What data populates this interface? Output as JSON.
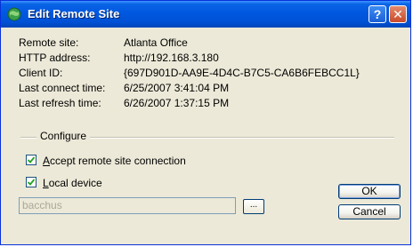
{
  "window": {
    "title": "Edit Remote Site",
    "help_label": "?",
    "close_label": "✕"
  },
  "info": {
    "rows": [
      {
        "label": "Remote site:",
        "value": "Atlanta Office"
      },
      {
        "label": "HTTP address:",
        "value": "http://192.168.3.180"
      },
      {
        "label": "Client ID:",
        "value": "{697D901D-AA9E-4D4C-B7C5-CA6B6FEBCC1L}"
      },
      {
        "label": "Last connect time:",
        "value": "6/25/2007 3:41:04 PM"
      },
      {
        "label": "Last refresh time:",
        "value": "6/26/2007 1:37:15 PM"
      }
    ]
  },
  "configure": {
    "group_label": "Configure",
    "accept": {
      "prefix": "",
      "accel": "A",
      "rest": "ccept remote site connection",
      "checked": true
    },
    "local": {
      "prefix": "",
      "accel": "L",
      "rest": "ocal device",
      "checked": true
    },
    "device_value": "bacchus",
    "browse_label": "..."
  },
  "buttons": {
    "ok": "OK",
    "cancel": "Cancel"
  }
}
